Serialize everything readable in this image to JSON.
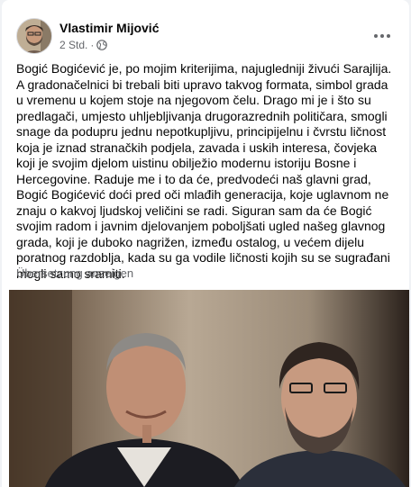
{
  "post": {
    "author": "Vlastimir Mijović",
    "time": "2 Std.",
    "text": "Bogić Bogićević je, po mojim kriterijima, najugledniji živući Sarajlija. A gradonačelnici bi trebali biti upravo takvog formata, simbol grada u vremenu u kojem stoje na njegovom čelu. Drago mi je i što su predlagači, umjesto uhljebljivanja drugorazrednih političara, smogli snage da podupru jednu nepotkupljivu, principijelnu i čvrstu ličnost koja je iznad stranačkih podjela, zavada i uskih interesa, čovjeka koji je svojim djelom uistinu obilježio modernu istoriju Bosne i Hercegovine. Raduje me i to da će, predvodeći naš glavni grad, Bogić Bogićević doći pred oči mlađih generacija, koje uglavnom ne znaju o kakvoj ljudskoj veličini se radi. Siguran sam da će Bogić svojim radom i javnim djelovanjem poboljšati ugled našeg glavnog grada, koji je duboko nagrižen, između ostalog, u većem dijelu poratnog razdoblja, kada su ga vodile ličnosti kojih su se sugrađani mogli samo sramiti.",
    "translate_label": "Übersetzung anzeigen"
  },
  "icons": {
    "audience": "globe-icon",
    "menu": "more-options-icon"
  },
  "colors": {
    "text": "#050505",
    "secondary": "#65676b",
    "background": "#f0f2f5"
  }
}
